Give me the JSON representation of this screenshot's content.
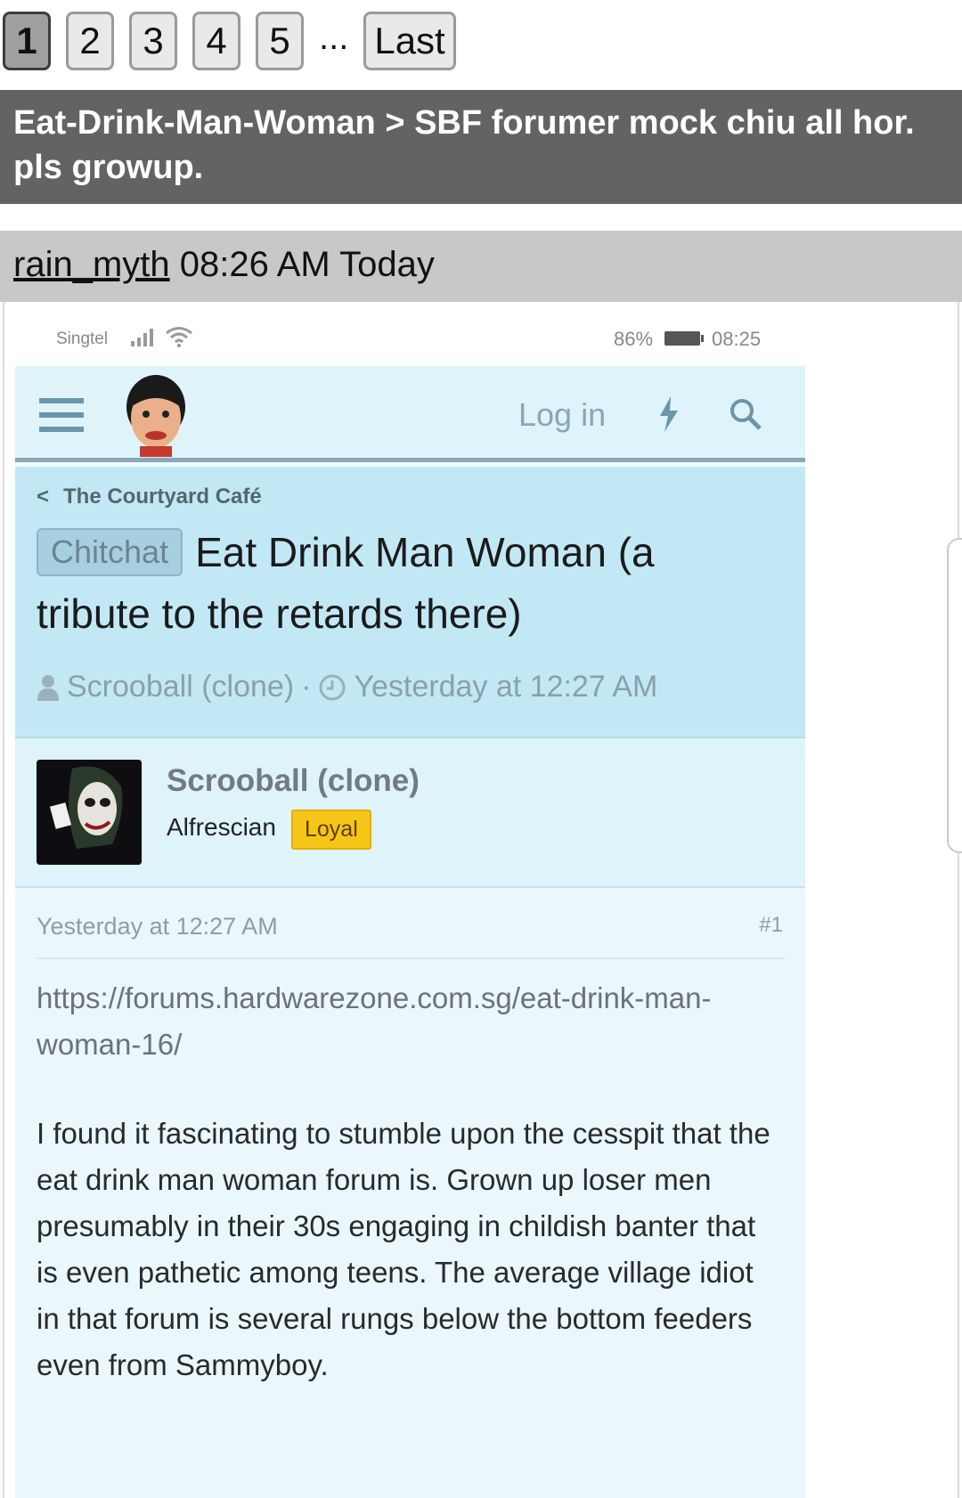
{
  "pagination": {
    "pages": [
      "1",
      "2",
      "3",
      "4",
      "5"
    ],
    "current": "1",
    "ellipsis": "...",
    "last_label": "Last"
  },
  "thread": {
    "breadcrumb_title": "Eat-Drink-Man-Woman > SBF forumer mock chiu all hor. pls growup."
  },
  "post": {
    "author": "rain_myth",
    "time": "08:26 AM Today"
  },
  "screenshot": {
    "status_bar": {
      "carrier": "Singtel",
      "battery": "86%",
      "time": "08:25"
    },
    "nav": {
      "login_label": "Log in"
    },
    "breadcrumb": "The Courtyard Café",
    "prefix": "Chitchat",
    "title": "Eat Drink Man Woman (a tribute to the retards there)",
    "meta": {
      "author": "Scrooball (clone)",
      "separator": "·",
      "time": "Yesterday at 12:27 AM"
    },
    "author_block": {
      "name": "Scrooball (clone)",
      "title": "Alfrescian",
      "badge": "Loyal"
    },
    "post": {
      "date": "Yesterday at 12:27 AM",
      "number": "#1",
      "link": "https://forums.hardwarezone.com.sg/eat-drink-man-woman-16/",
      "text": "I found it fascinating to stumble upon the cesspit that the eat drink man woman forum is. Grown up loser men presumably in their 30s engaging in childish banter that is even pathetic among teens. The average village idiot in that forum is several rungs below the bottom feeders even from Sammyboy."
    }
  },
  "colors": {
    "banner": "#636363",
    "post_header": "#c8c8c8",
    "app_nav": "#dff3fa",
    "thread_head": "#c2e8f5",
    "badge_yellow": "#f7c418"
  }
}
